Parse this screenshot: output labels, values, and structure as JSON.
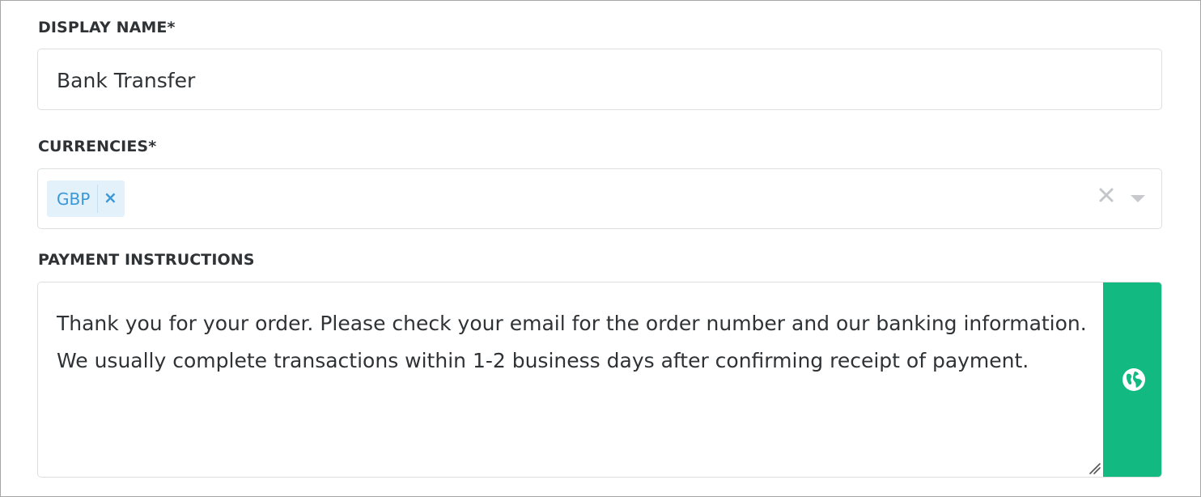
{
  "form": {
    "display_name": {
      "label": "DISPLAY NAME*",
      "value": "Bank Transfer"
    },
    "currencies": {
      "label": "CURRENCIES*",
      "selected": [
        {
          "code": "GBP",
          "remove_glyph": "×"
        }
      ],
      "clear_icon": "close-icon",
      "dropdown_icon": "chevron-down-icon"
    },
    "payment_instructions": {
      "label": "PAYMENT INSTRUCTIONS",
      "value": "Thank you for your order. Please check your email for the order number and our banking information. We usually complete transactions within 1-2 business days after confirming receipt of payment.",
      "action_icon": "globe-icon"
    }
  },
  "colors": {
    "tag_bg": "#e3f1fb",
    "tag_text": "#3a98d6",
    "action_button": "#12b981",
    "border": "#dcdfe2"
  }
}
